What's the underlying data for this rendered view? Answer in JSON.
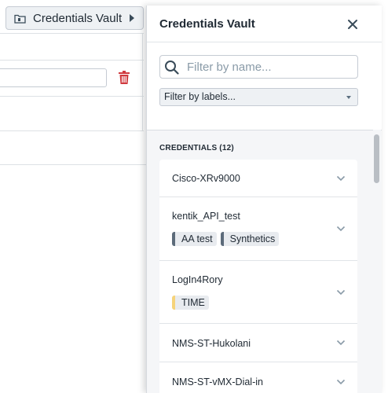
{
  "background": {
    "vault_button_label": "Credentials Vault"
  },
  "drawer": {
    "title": "Credentials Vault",
    "search": {
      "placeholder": "Filter by name...",
      "value": ""
    },
    "label_filter": {
      "selected": "Filter by labels..."
    },
    "section_title": "CREDENTIALS (12)",
    "credentials": [
      {
        "name": "Cisco-XRv9000",
        "tags": []
      },
      {
        "name": "kentik_API_test",
        "tags": [
          {
            "label": "AA test",
            "color": "#5c6b7a"
          },
          {
            "label": "Synthetics",
            "color": "#5c6b7a"
          }
        ]
      },
      {
        "name": "LogIn4Rory",
        "tags": [
          {
            "label": "TIME",
            "color": "#f6d37a"
          }
        ]
      },
      {
        "name": "NMS-ST-Hukolani",
        "tags": []
      },
      {
        "name": "NMS-ST-vMX-Dial-in",
        "tags": []
      }
    ]
  },
  "colors": {
    "delete_red": "#d0393e",
    "tag_gray": "#5c6b7a",
    "tag_yellow": "#f6d37a"
  },
  "icons": {
    "folder": "folder-icon",
    "caret": "caret-right-icon",
    "trash": "trash-icon",
    "close": "close-icon",
    "search": "search-icon",
    "dropdown": "caret-down-icon",
    "expand": "chevron-down-icon"
  }
}
